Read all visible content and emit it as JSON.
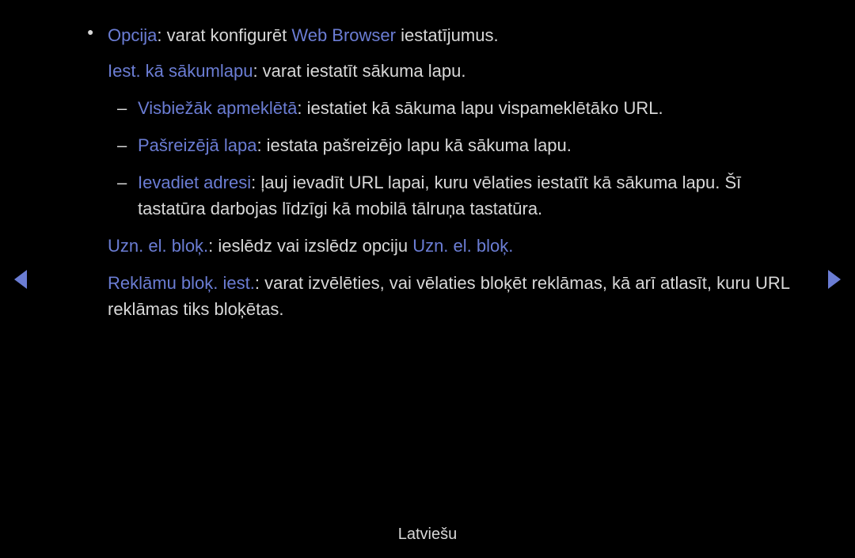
{
  "item1": {
    "label": "Opcija",
    "text1": ": varat konfigurēt ",
    "highlight": "Web Browser",
    "text2": " iestatījumus."
  },
  "item2": {
    "label": "Iest. kā sākumlapu",
    "text": ": varat iestatīt sākuma lapu."
  },
  "sub1": {
    "label": "Visbiežāk apmeklētā",
    "text": ": iestatiet kā sākuma lapu vispameklētāko URL."
  },
  "sub2": {
    "label": "Pašreizējā lapa",
    "text": ": iestata pašreizējo lapu kā sākuma lapu."
  },
  "sub3": {
    "label": "Ievadiet adresi",
    "text": ": ļauj ievadīt URL lapai, kuru vēlaties iestatīt kā sākuma lapu. Šī tastatūra darbojas līdzīgi kā mobilā tālruņa tastatūra."
  },
  "item3": {
    "label": "Uzn. el. bloķ.",
    "text1": ": ieslēdz vai izslēdz opciju ",
    "highlight": "Uzn. el. bloķ.",
    "text2": ""
  },
  "item4": {
    "label": "Reklāmu bloķ. iest.",
    "text": ": varat izvēlēties, vai vēlaties bloķēt reklāmas, kā arī atlasīt, kuru URL reklāmas tiks bloķētas."
  },
  "footer": "Latviešu"
}
